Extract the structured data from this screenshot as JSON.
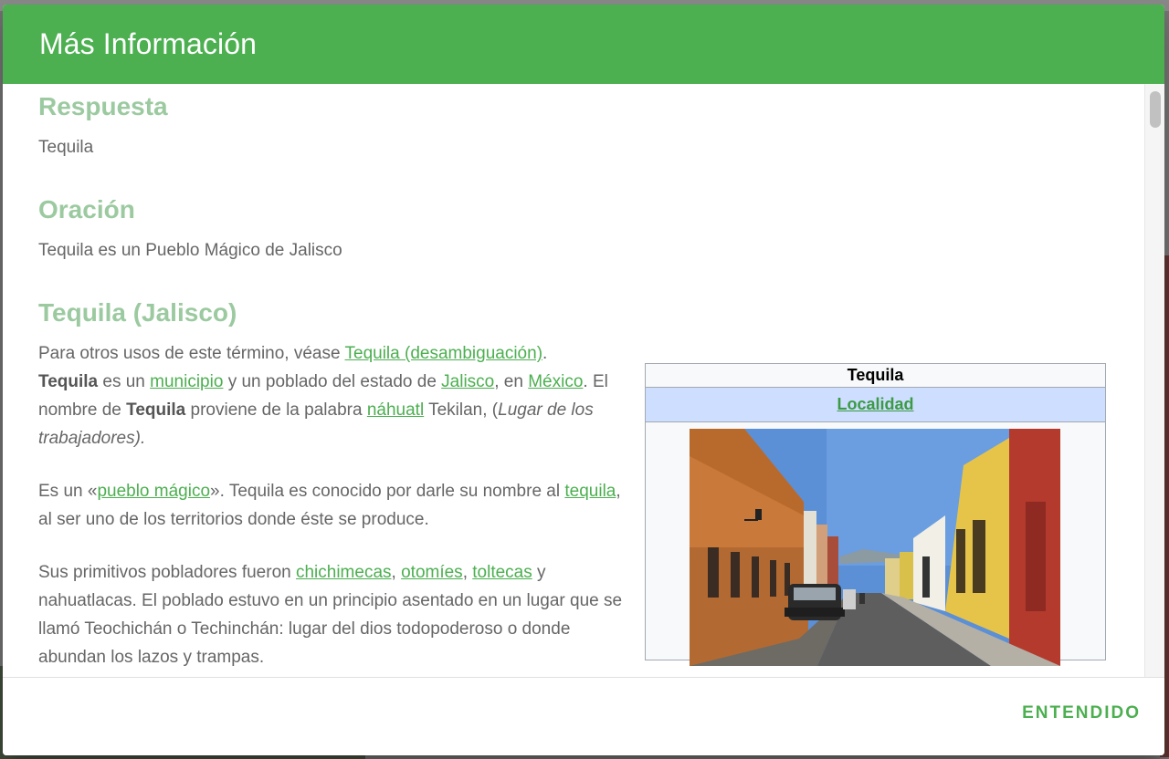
{
  "dialog": {
    "title": "Más Información",
    "ok_label": "ENTENDIDO"
  },
  "respuesta": {
    "heading": "Respuesta",
    "text": "Tequila"
  },
  "oracion": {
    "heading": "Oración",
    "text": "Tequila es un Pueblo Mágico de Jalisco"
  },
  "article": {
    "heading": "Tequila (Jalisco)",
    "p1": {
      "t1": "Para otros usos de este término, véase ",
      "link_disambig": "Tequila (desambiguación)",
      "t2": ".",
      "bold_tequila": "Tequila",
      "t3": " es un ",
      "link_municipio": "municipio",
      "t4": " y un poblado del estado de ",
      "link_jalisco": "Jalisco",
      "t5": ", en ",
      "link_mexico": "México",
      "t6": ". El nombre de ",
      "bold_tequila2": "Tequila",
      "t7": " proviene de la palabra ",
      "link_nahuatl": "náhuatl",
      "t8": " Tekilan, (",
      "italic": "Lugar de los trabajadores).",
      "t9": ""
    },
    "p2": {
      "t1": "Es un «",
      "link_pueblo": "pueblo mágico",
      "t2": "». Tequila es conocido por darle su nombre al ",
      "link_tequila": "tequila",
      "t3": ", al ser uno de los territorios donde éste se produce."
    },
    "p3": {
      "t1": "Sus primitivos pobladores fueron ",
      "link_chichimecas": "chichimecas",
      "sep1": ", ",
      "link_otomies": "otomíes",
      "sep2": ", ",
      "link_toltecas": "toltecas",
      "t2": " y nahuatlacas. El poblado estuvo en un principio asentado en un lugar que se llamó Teochichán o Techinchán: lugar del dios todopoderoso o donde abundan los lazos y trampas."
    }
  },
  "infobox": {
    "title": "Tequila",
    "subtitle_link": "Localidad"
  },
  "colors": {
    "header": "#4caf50",
    "heading": "#9ccaa0",
    "link": "#4caf50",
    "infobox_sub_bg": "#cddeff"
  }
}
